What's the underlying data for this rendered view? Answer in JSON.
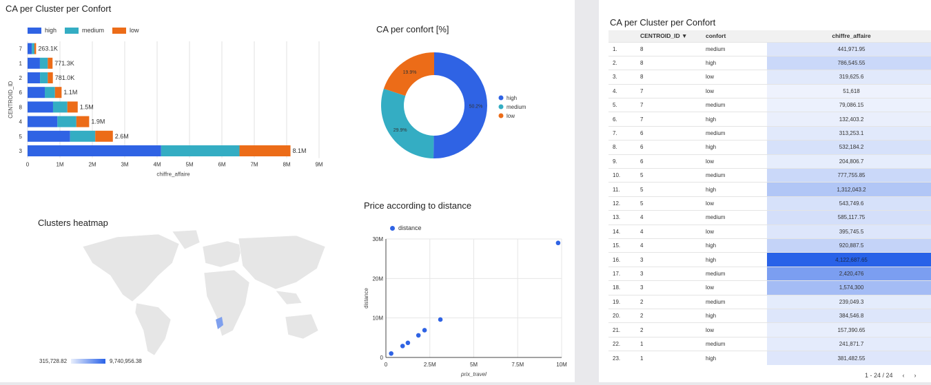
{
  "bar_chart": {
    "title": "CA per Cluster per Confort",
    "chart_data": {
      "type": "bar",
      "orientation": "horizontal",
      "stacked": true,
      "categories": [
        "7",
        "1",
        "2",
        "6",
        "8",
        "4",
        "5",
        "3"
      ],
      "series": [
        {
          "name": "high",
          "values": [
            0.132403,
            0.381483,
            0.384547,
            0.532184,
            0.786546,
            0.920888,
            1.312043,
            4.122688
          ]
        },
        {
          "name": "medium",
          "values": [
            0.079086,
            0.241872,
            0.239049,
            0.313253,
            0.441972,
            0.585118,
            0.777756,
            2.420476
          ]
        },
        {
          "name": "low",
          "values": [
            0.051618,
            0.147945,
            0.157391,
            0.204807,
            0.319626,
            0.395746,
            0.54375,
            1.5743
          ]
        }
      ],
      "totals": [
        "263.1K",
        "771.3K",
        "781.0K",
        "1.1M",
        "1.5M",
        "1.9M",
        "2.6M",
        "8.1M"
      ],
      "xlabel": "chiffre_affaire",
      "ylabel": "CENTROID_ID",
      "xticks": [
        "0",
        "1M",
        "2M",
        "3M",
        "4M",
        "5M",
        "6M",
        "7M",
        "8M",
        "9M"
      ],
      "xlim": [
        0,
        9
      ],
      "grid": true,
      "legend_position": "top-left"
    }
  },
  "donut_chart": {
    "title": "CA per confort [%]",
    "chart_data": {
      "type": "pie",
      "donut": true,
      "categories": [
        "high",
        "medium",
        "low"
      ],
      "values": [
        50.2,
        29.9,
        19.9
      ],
      "labels": [
        "50.2%",
        "29.9%",
        "19.9%"
      ],
      "legend_position": "right"
    }
  },
  "scatter_chart": {
    "title": "Price according to distance",
    "chart_data": {
      "type": "scatter",
      "series": [
        {
          "name": "distance",
          "x": [
            0.3,
            0.95,
            1.25,
            1.85,
            2.2,
            3.1,
            9.8
          ],
          "y": [
            1.0,
            2.9,
            3.7,
            5.6,
            6.9,
            9.6,
            29.0
          ]
        }
      ],
      "xlabel": "prix_travel",
      "ylabel": "distance",
      "xticks": [
        "0",
        "2.5M",
        "5M",
        "7.5M",
        "10M"
      ],
      "yticks": [
        "0",
        "10M",
        "20M",
        "30M"
      ],
      "xlim": [
        0,
        10
      ],
      "ylim": [
        0,
        30
      ],
      "legend_position": "top-left"
    }
  },
  "heatmap": {
    "title": "Clusters heatmap",
    "min_label": "315,728.82",
    "max_label": "9,740,956.38"
  },
  "table": {
    "title": "CA per Cluster per Confort",
    "columns": [
      "CENTROID_ID",
      "confort",
      "chiffre_affaire"
    ],
    "sort_indicator": "▼",
    "rows": [
      [
        "1.",
        "8",
        "medium",
        "441,971.95"
      ],
      [
        "2.",
        "8",
        "high",
        "786,545.55"
      ],
      [
        "3.",
        "8",
        "low",
        "319,625.6"
      ],
      [
        "4.",
        "7",
        "low",
        "51,618"
      ],
      [
        "5.",
        "7",
        "medium",
        "79,086.15"
      ],
      [
        "6.",
        "7",
        "high",
        "132,403.2"
      ],
      [
        "7.",
        "6",
        "medium",
        "313,253.1"
      ],
      [
        "8.",
        "6",
        "high",
        "532,184.2"
      ],
      [
        "9.",
        "6",
        "low",
        "204,806.7"
      ],
      [
        "10.",
        "5",
        "medium",
        "777,755.85"
      ],
      [
        "11.",
        "5",
        "high",
        "1,312,043.2"
      ],
      [
        "12.",
        "5",
        "low",
        "543,749.6"
      ],
      [
        "13.",
        "4",
        "medium",
        "585,117.75"
      ],
      [
        "14.",
        "4",
        "low",
        "395,745.5"
      ],
      [
        "15.",
        "4",
        "high",
        "920,887.5"
      ],
      [
        "16.",
        "3",
        "high",
        "4,122,687.65"
      ],
      [
        "17.",
        "3",
        "medium",
        "2,420,476"
      ],
      [
        "18.",
        "3",
        "low",
        "1,574,300"
      ],
      [
        "19.",
        "2",
        "medium",
        "239,049.3"
      ],
      [
        "20.",
        "2",
        "high",
        "384,546.8"
      ],
      [
        "21.",
        "2",
        "low",
        "157,390.65"
      ],
      [
        "22.",
        "1",
        "medium",
        "241,871.7"
      ],
      [
        "23.",
        "1",
        "high",
        "381,482.55"
      ]
    ],
    "pagination": "1 - 24 / 24",
    "prev_icon": "chevron-left-icon",
    "next_icon": "chevron-right-icon"
  },
  "colors": {
    "high": "#2f63e4",
    "medium": "#34adc3",
    "low": "#ec6c18"
  }
}
